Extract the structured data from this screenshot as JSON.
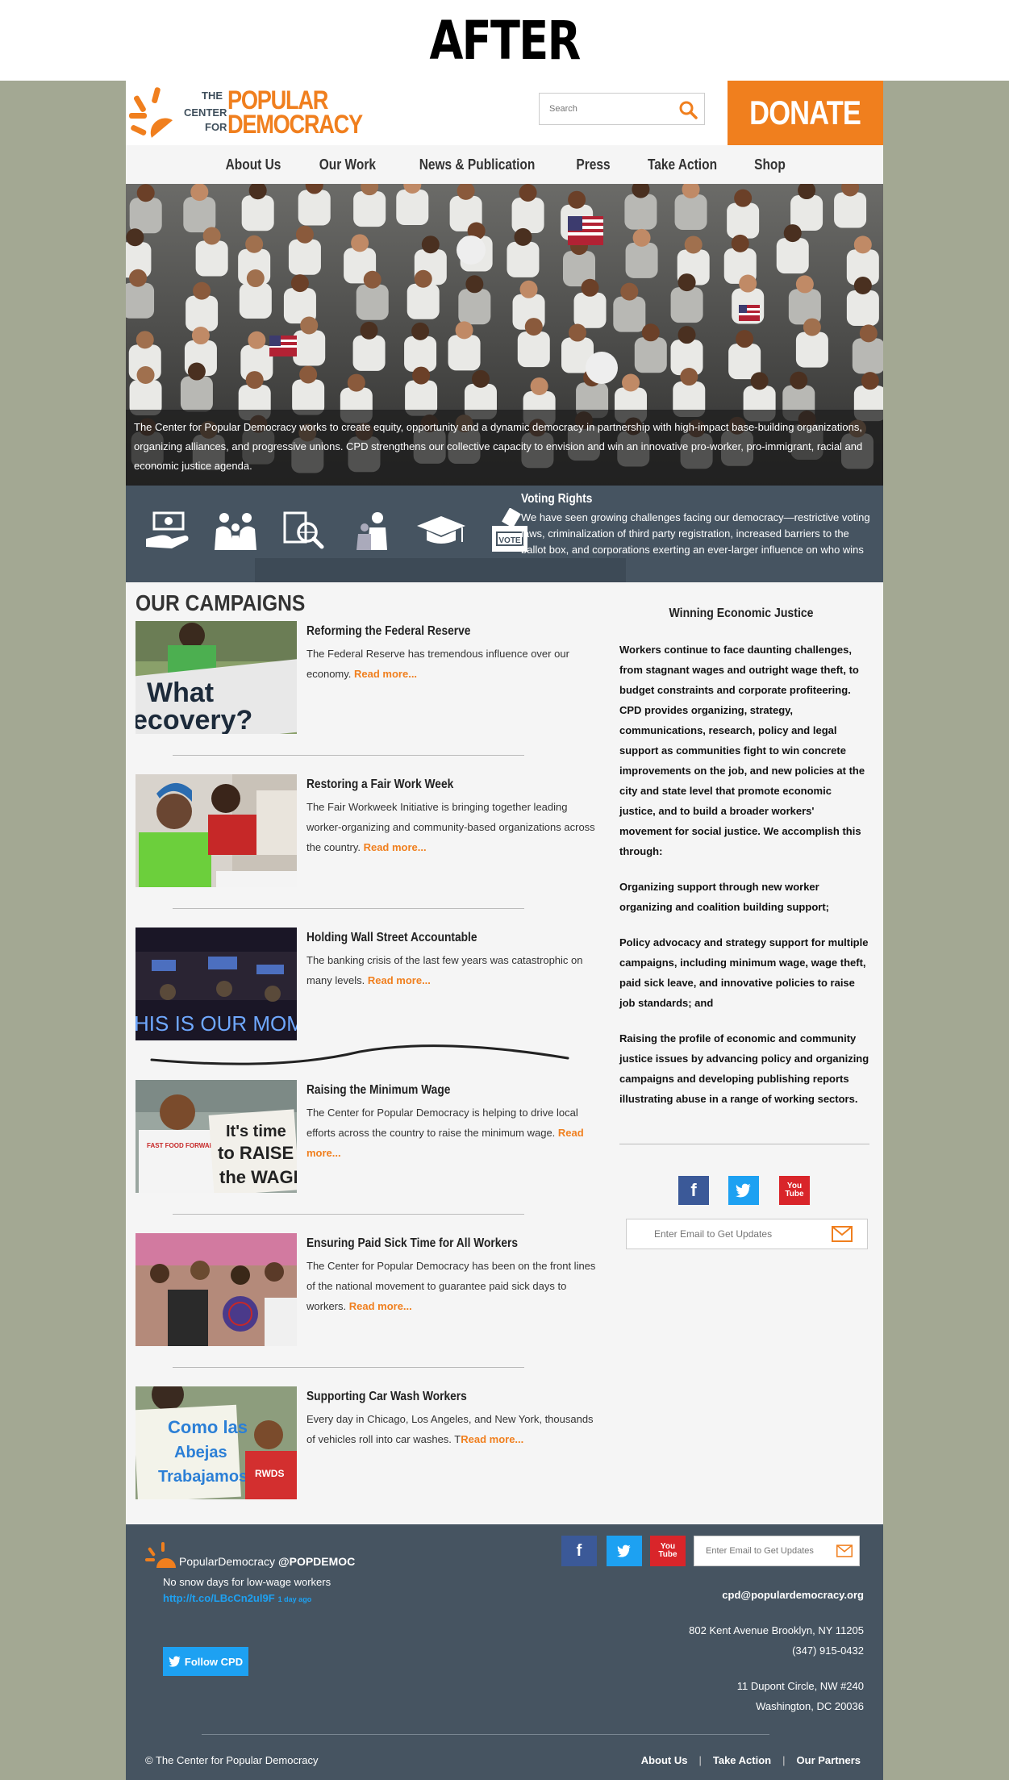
{
  "banner": {
    "label": "AFTER"
  },
  "header": {
    "logo": {
      "the": "THE",
      "center": "CENTER",
      "for": "FOR",
      "popular": "POPULAR",
      "democracy": "DEMOCRACY"
    },
    "search_placeholder": "Search",
    "donate_label": "DONATE"
  },
  "nav": {
    "items": [
      {
        "label": "About Us"
      },
      {
        "label": "Our Work"
      },
      {
        "label": "News & Publication"
      },
      {
        "label": "Press"
      },
      {
        "label": "Take Action"
      },
      {
        "label": "Shop"
      }
    ]
  },
  "hero": {
    "caption": "The Center for Popular Democracy works to create equity, opportunity and a dynamic democracy in partnership with high-impact base-building organizations, organizing alliances, and progressive unions. CPD strengthens our collective capacity to envision and win an innovative pro-worker, pro-immigrant, racial and economic justice agenda."
  },
  "issues": {
    "icons": [
      "money-hand-icon",
      "family-icon",
      "globe-search-icon",
      "people-icon",
      "graduation-cap-icon",
      "ballot-box-icon"
    ],
    "ballot_label": "VOTE",
    "active_title": "Voting Rights",
    "active_text": "We have seen growing challenges facing our democracy—restrictive voting laws, criminalization of third party registration, increased barriers to the ballot box, and corporations exerting an ever-larger influence on who wins"
  },
  "campaigns": {
    "heading": "OUR CAMPAIGNS",
    "read_more": "Read more...",
    "items": [
      {
        "title": "Reforming the Federal Reserve",
        "text": "The Federal Reserve has tremendous influence over our economy. ",
        "read_more": "Read more...",
        "photo_text_1": "What",
        "photo_text_2": "ecovery?"
      },
      {
        "title": "Restoring a Fair Work Week",
        "text": "The Fair Workweek Initiative is bringing together leading worker-organizing and community-based organizations across the country. ",
        "read_more": "Read more..."
      },
      {
        "title": "Holding Wall Street Accountable",
        "text": "The banking crisis of the last few years was catastrophic on many levels. ",
        "read_more": "Read more...",
        "photo_text_1": "HIS IS OUR MOMEN"
      },
      {
        "title": "Raising the Minimum Wage",
        "text": "The Center for Popular Democracy is helping to drive local efforts across the country to raise the minimum wage. ",
        "read_more": "Read more...",
        "photo_text_1": "It's time",
        "photo_text_2": "to RAISE",
        "photo_text_3": "the WAGE",
        "photo_text_4": "FAST FOOD FORWARD"
      },
      {
        "title": "Ensuring Paid Sick Time for All Workers",
        "text": "The Center for Popular Democracy has been on the front lines of the national movement to guarantee paid sick days to workers. ",
        "read_more": "Read more..."
      },
      {
        "title": "Supporting Car Wash Workers",
        "text": "Every day in Chicago, Los Angeles, and New York, thousands of vehicles roll into car washes. T",
        "read_more": "Read more...",
        "photo_text_1": "Como las",
        "photo_text_2": "Abejas",
        "photo_text_3": "Trabajamos",
        "photo_text_4": "RWDS"
      }
    ]
  },
  "sidebar": {
    "title": "Winning Economic Justice",
    "paragraphs": [
      "Workers continue to face daunting challenges, from stagnant wages and outright wage theft, to budget constraints and corporate profiteering. CPD provides organizing, strategy, communications, research, policy and legal support as communities fight to win concrete improvements on the job, and new policies at the city and state level that promote economic justice, and to build a broader workers' movement for social justice. We accomplish this through:",
      "Organizing support through new worker organizing and coalition building support;",
      "Policy advocacy and strategy support for multiple campaigns, including minimum wage, wage theft, paid sick leave, and innovative policies to raise job standards; and",
      "Raising the profile of economic and community justice issues by advancing policy and organizing campaigns and developing publishing reports illustrating abuse in a range of working sectors."
    ],
    "social": {
      "fb": "f",
      "tw": "twitter-icon",
      "yt_label": "You Tube"
    },
    "email_placeholder": "Enter Email to Get Updates"
  },
  "footer": {
    "twitter_name": "PopularDemocracy",
    "twitter_handle": "@POPDEMOC",
    "tweet": "No snow days for low-wage workers",
    "tweet_link": "http://t.co/LBcCn2ul9F",
    "tweet_time": "1 day ago",
    "follow_label": "Follow CPD",
    "email_placeholder": "Enter Email to Get Updates",
    "contact_email": "cpd@populardemocracy.org",
    "address1_line1": "802 Kent Avenue Brooklyn, NY 11205",
    "address1_line2": "(347) 915-0432",
    "address2_line1": "11 Dupont Circle, NW #240",
    "address2_line2": "Washington, DC 20036",
    "copyright": "© The Center for Popular Democracy",
    "links": [
      {
        "label": "About Us"
      },
      {
        "label": "Take Action"
      },
      {
        "label": "Our Partners"
      }
    ],
    "pipe": "|",
    "yt_label": "You Tube"
  },
  "colors": {
    "accent": "#f07f1e",
    "dark": "#465461",
    "facebook": "#3b5998",
    "twitter": "#1da1f2",
    "youtube": "#d9252a"
  }
}
